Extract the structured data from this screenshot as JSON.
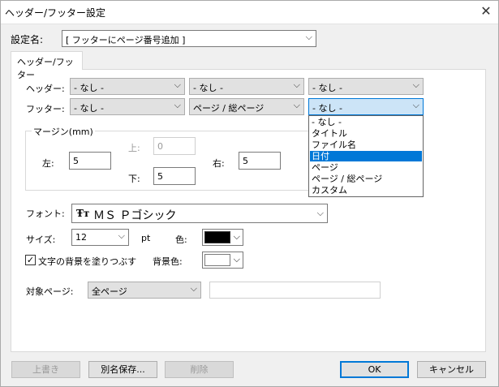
{
  "window": {
    "title": "ヘッダー/フッター設定",
    "close": "✕"
  },
  "setting": {
    "label": "設定名:",
    "value": "[ フッターにページ番号追加 ]"
  },
  "tab": {
    "label": "ヘッダー/フッター"
  },
  "header": {
    "label": "ヘッダー:",
    "left": "- なし -",
    "center": "- なし -",
    "right": "- なし -"
  },
  "footer": {
    "label": "フッター:",
    "left": "- なし -",
    "center": "ページ / 総ページ",
    "right": "- なし -"
  },
  "dropdown_options": [
    "- なし -",
    "タイトル",
    "ファイル名",
    "日付",
    "ページ",
    "ページ / 総ページ",
    "カスタム"
  ],
  "dropdown_selected_index": 3,
  "margin": {
    "legend": "マージン(mm)",
    "left_label": "左:",
    "left_value": "5",
    "top_label": "上:",
    "top_value": "0",
    "bottom_label": "下:",
    "bottom_value": "5",
    "right_label": "右:",
    "right_value": "5"
  },
  "font": {
    "label": "フォント:",
    "icon_glyph": "Ŧт",
    "value": "ＭＳ Ｐゴシック"
  },
  "size": {
    "label": "サイズ:",
    "value": "12",
    "unit": "pt"
  },
  "color": {
    "label": "色:",
    "swatch": "#000000"
  },
  "bg": {
    "checkbox_label": "文字の背景を塗りつぶす",
    "checked": true,
    "check_glyph": "✓",
    "label": "背景色:",
    "swatch": "#ffffff"
  },
  "target": {
    "label": "対象ページ:",
    "value": "全ページ",
    "extra_value": ""
  },
  "buttons": {
    "overwrite": "上書き",
    "save_as": "別名保存...",
    "delete": "削除",
    "ok": "OK",
    "cancel": "キャンセル"
  },
  "arrow": "⌵"
}
